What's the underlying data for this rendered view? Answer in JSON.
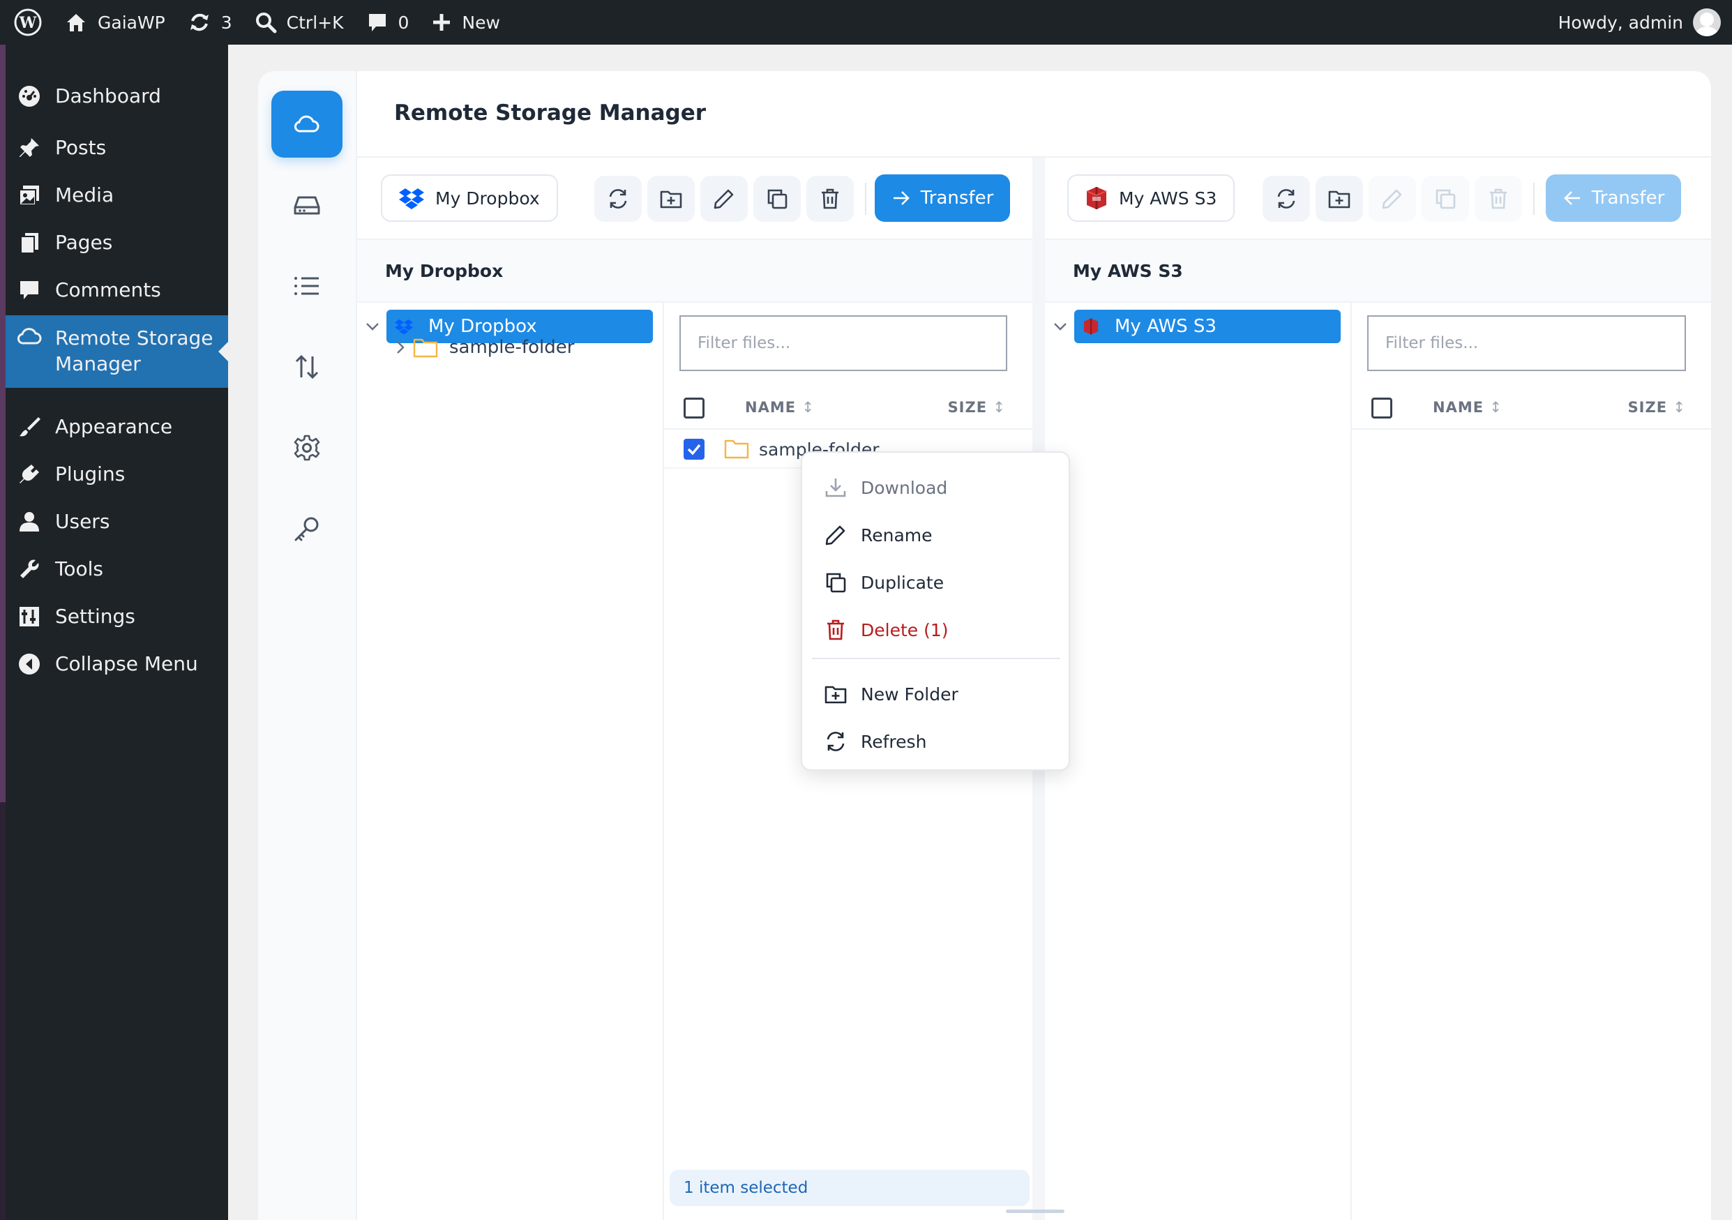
{
  "adminbar": {
    "site_name": "GaiaWP",
    "updates_count": "3",
    "search_shortcut": "Ctrl+K",
    "comments_count": "0",
    "new_label": "New",
    "greeting": "Howdy, admin"
  },
  "sidebar": {
    "items": [
      {
        "label": "Dashboard",
        "icon": "dashboard-icon"
      },
      {
        "label": "Posts",
        "icon": "pin-icon"
      },
      {
        "label": "Media",
        "icon": "media-icon"
      },
      {
        "label": "Pages",
        "icon": "pages-icon"
      },
      {
        "label": "Comments",
        "icon": "comment-icon"
      },
      {
        "label": "Remote Storage Manager",
        "icon": "cloud-icon"
      },
      {
        "label": "Appearance",
        "icon": "brush-icon"
      },
      {
        "label": "Plugins",
        "icon": "plug-icon"
      },
      {
        "label": "Users",
        "icon": "user-icon"
      },
      {
        "label": "Tools",
        "icon": "wrench-icon"
      },
      {
        "label": "Settings",
        "icon": "settings-icon"
      },
      {
        "label": "Collapse Menu",
        "icon": "collapse-icon"
      }
    ],
    "active": "Remote Storage Manager",
    "remote_storage_line1": "Remote Storage",
    "remote_storage_line2": "Manager"
  },
  "page": {
    "title": "Remote Storage Manager"
  },
  "left_panel": {
    "source_label": "My Dropbox",
    "transfer_label": "Transfer",
    "section_title": "My Dropbox",
    "tree": {
      "root": "My Dropbox",
      "children": [
        "sample-folder"
      ]
    },
    "filter_placeholder": "Filter files...",
    "columns": {
      "name": "NAME",
      "size": "SIZE"
    },
    "files": [
      {
        "name": "sample-folder",
        "checked": true
      }
    ],
    "status": "1 item selected"
  },
  "right_panel": {
    "source_label": "My AWS S3",
    "transfer_label": "Transfer",
    "section_title": "My AWS S3",
    "tree": {
      "root": "My AWS S3"
    },
    "filter_placeholder": "Filter files...",
    "columns": {
      "name": "NAME",
      "size": "SIZE"
    }
  },
  "context_menu": {
    "items": [
      {
        "label": "Download",
        "state": "disabled"
      },
      {
        "label": "Rename",
        "state": "normal"
      },
      {
        "label": "Duplicate",
        "state": "normal"
      },
      {
        "label": "Delete (1)",
        "state": "danger"
      },
      {
        "label": "New Folder",
        "state": "normal"
      },
      {
        "label": "Refresh",
        "state": "normal"
      }
    ]
  },
  "colors": {
    "admin_bar": "#1d2327",
    "accent": "#1d8ae6",
    "wp_active": "#2271b1",
    "danger": "#b91c1c",
    "folder": "#f5b545"
  }
}
